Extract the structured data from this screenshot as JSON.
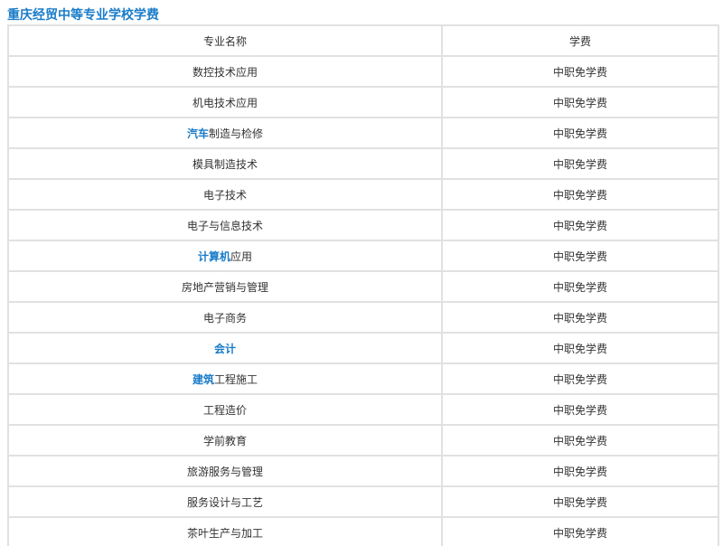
{
  "title": "重庆经贸中等专业学校学费",
  "headers": [
    "专业名称",
    "学费"
  ],
  "colors": {
    "title": "#1a7cc9",
    "link": "#1a7cc9",
    "border": "#e1e1e1",
    "text": "#333333"
  },
  "rows": [
    {
      "link": "",
      "name": "数控技术应用",
      "fee": "中职免学费"
    },
    {
      "link": "",
      "name": "机电技术应用",
      "fee": "中职免学费"
    },
    {
      "link": "汽车",
      "name": "制造与检修",
      "fee": "中职免学费"
    },
    {
      "link": "",
      "name": "模具制造技术",
      "fee": "中职免学费"
    },
    {
      "link": "",
      "name": "电子技术",
      "fee": "中职免学费"
    },
    {
      "link": "",
      "name": "电子与信息技术",
      "fee": "中职免学费"
    },
    {
      "link": "计算机",
      "name": "应用",
      "fee": "中职免学费"
    },
    {
      "link": "",
      "name": "房地产营销与管理",
      "fee": "中职免学费"
    },
    {
      "link": "",
      "name": "电子商务",
      "fee": "中职免学费"
    },
    {
      "link": "会计",
      "name": "",
      "fee": "中职免学费"
    },
    {
      "link": "建筑",
      "name": "工程施工",
      "fee": "中职免学费"
    },
    {
      "link": "",
      "name": "工程造价",
      "fee": "中职免学费"
    },
    {
      "link": "",
      "name": "学前教育",
      "fee": "中职免学费"
    },
    {
      "link": "",
      "name": "旅游服务与管理",
      "fee": "中职免学费"
    },
    {
      "link": "",
      "name": "服务设计与工艺",
      "fee": "中职免学费"
    },
    {
      "link": "",
      "name": "茶叶生产与加工",
      "fee": "中职免学费"
    }
  ]
}
